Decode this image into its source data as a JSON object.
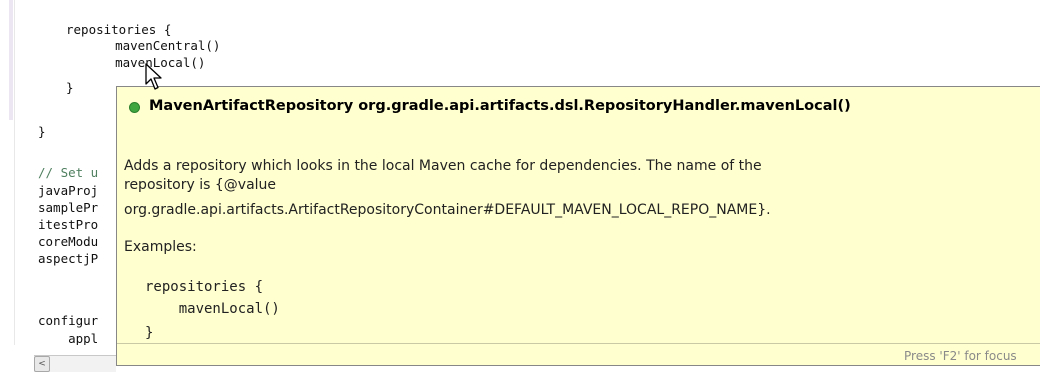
{
  "editor": {
    "lines": [
      "repositories {",
      "    mavenCentral()",
      "    mavenLocal()",
      "}",
      "}",
      "// Set u",
      "javaProj",
      "samplePr",
      "itestPro",
      "coreModu",
      "aspectjP",
      "configur",
      "    appl"
    ]
  },
  "popup": {
    "signature": "MavenArtifactRepository org.gradle.api.artifacts.dsl.RepositoryHandler.mavenLocal()",
    "description_line1": "Adds a repository which looks in the local Maven cache for dependencies. The name of the",
    "description_line2": "repository is {@value",
    "description_line3": "org.gradle.api.artifacts.ArtifactRepositoryContainer#DEFAULT_MAVEN_LOCAL_REPO_NAME}.",
    "examples_label": "Examples:",
    "example_code": [
      "repositories {",
      "    mavenLocal()",
      "}"
    ],
    "status": "Press 'F2' for focus"
  },
  "scrollbar": {
    "left_arrow": "<"
  }
}
